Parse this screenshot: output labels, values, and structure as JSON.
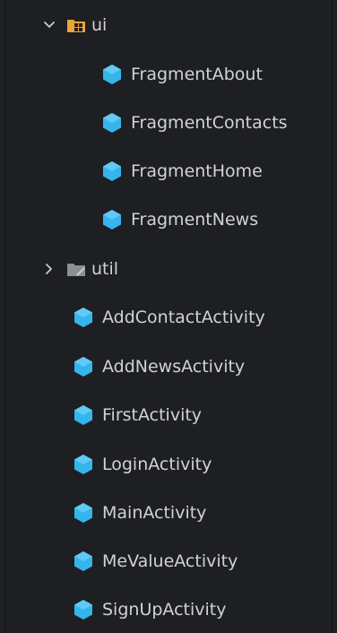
{
  "tree": {
    "ui_folder": {
      "label": "ui",
      "expanded": true,
      "icon": "package-folder-icon"
    },
    "ui_children": [
      {
        "label": "FragmentAbout",
        "icon": "class-icon"
      },
      {
        "label": "FragmentContacts",
        "icon": "class-icon"
      },
      {
        "label": "FragmentHome",
        "icon": "class-icon"
      },
      {
        "label": "FragmentNews",
        "icon": "class-icon"
      }
    ],
    "util_folder": {
      "label": "util",
      "expanded": false,
      "icon": "folder-icon"
    },
    "classes": [
      {
        "label": "AddContactActivity",
        "icon": "class-icon"
      },
      {
        "label": "AddNewsActivity",
        "icon": "class-icon"
      },
      {
        "label": "FirstActivity",
        "icon": "class-icon"
      },
      {
        "label": "LoginActivity",
        "icon": "class-icon"
      },
      {
        "label": "MainActivity",
        "icon": "class-icon"
      },
      {
        "label": "MeValueActivity",
        "icon": "class-icon"
      },
      {
        "label": "SignUpActivity",
        "icon": "class-icon"
      }
    ]
  },
  "colors": {
    "background": "#1e1f22",
    "text": "#d0d2d6",
    "class_icon": "#36b4ec",
    "package_folder": "#e8a33b",
    "folder": "#8b9098"
  }
}
